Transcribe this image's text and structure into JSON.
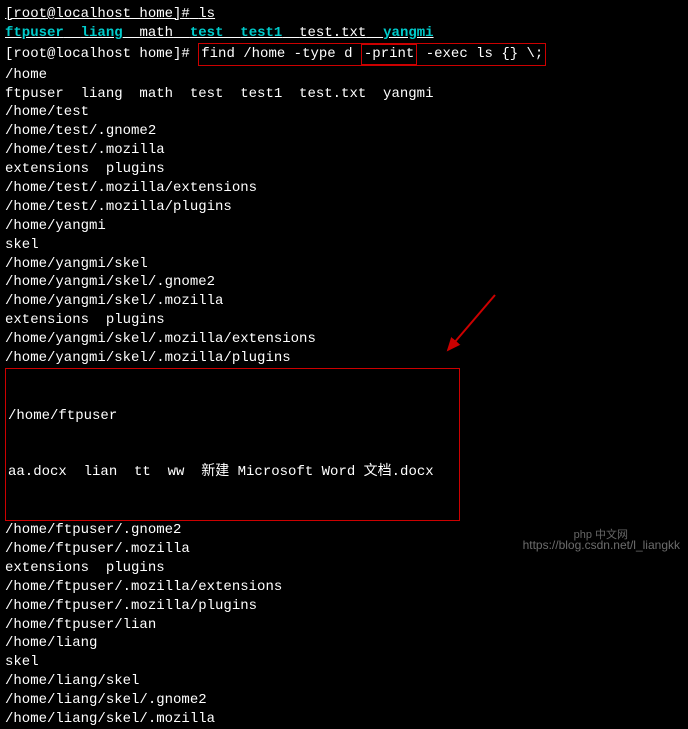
{
  "prompt1": {
    "user": "[root@localhost home]#",
    "cmd": "ls"
  },
  "ls_out": {
    "i0": "ftpuser",
    "i1": "liang",
    "i2": "math",
    "i3": "test",
    "i4": "test1",
    "i5": "test.txt",
    "i6": "yangmi"
  },
  "prompt2": {
    "user": "[root@localhost home]#",
    "cmd_pre": "find /home -type d ",
    "cmd_box": "-print",
    "cmd_post": " -exec ls {} \\;"
  },
  "lines": {
    "l0": "/home",
    "l1": "ftpuser  liang  math  test  test1  test.txt  yangmi",
    "l2": "/home/test",
    "l3": "/home/test/.gnome2",
    "l4": "/home/test/.mozilla",
    "l5": "extensions  plugins",
    "l6": "/home/test/.mozilla/extensions",
    "l7": "/home/test/.mozilla/plugins",
    "l8": "/home/yangmi",
    "l9": "skel",
    "l10": "/home/yangmi/skel",
    "l11": "/home/yangmi/skel/.gnome2",
    "l12": "/home/yangmi/skel/.mozilla",
    "l13": "extensions  plugins",
    "l14": "/home/yangmi/skel/.mozilla/extensions",
    "l15": "/home/yangmi/skel/.mozilla/plugins",
    "l16": "/home/ftpuser",
    "l17": "aa.docx  lian  tt  ww  新建 Microsoft Word 文档.docx",
    "l18": "/home/ftpuser/.gnome2",
    "l19": "/home/ftpuser/.mozilla",
    "l20": "extensions  plugins",
    "l21": "/home/ftpuser/.mozilla/extensions",
    "l22": "/home/ftpuser/.mozilla/plugins",
    "l23": "/home/ftpuser/lian",
    "l24": "/home/liang",
    "l25": "skel",
    "l26": "/home/liang/skel",
    "l27": "/home/liang/skel/.gnome2",
    "l28": "/home/liang/skel/.mozilla"
  },
  "watermark": {
    "url": "https://blog.csdn.net/l_liangkk",
    "logo": "php 中文网"
  }
}
